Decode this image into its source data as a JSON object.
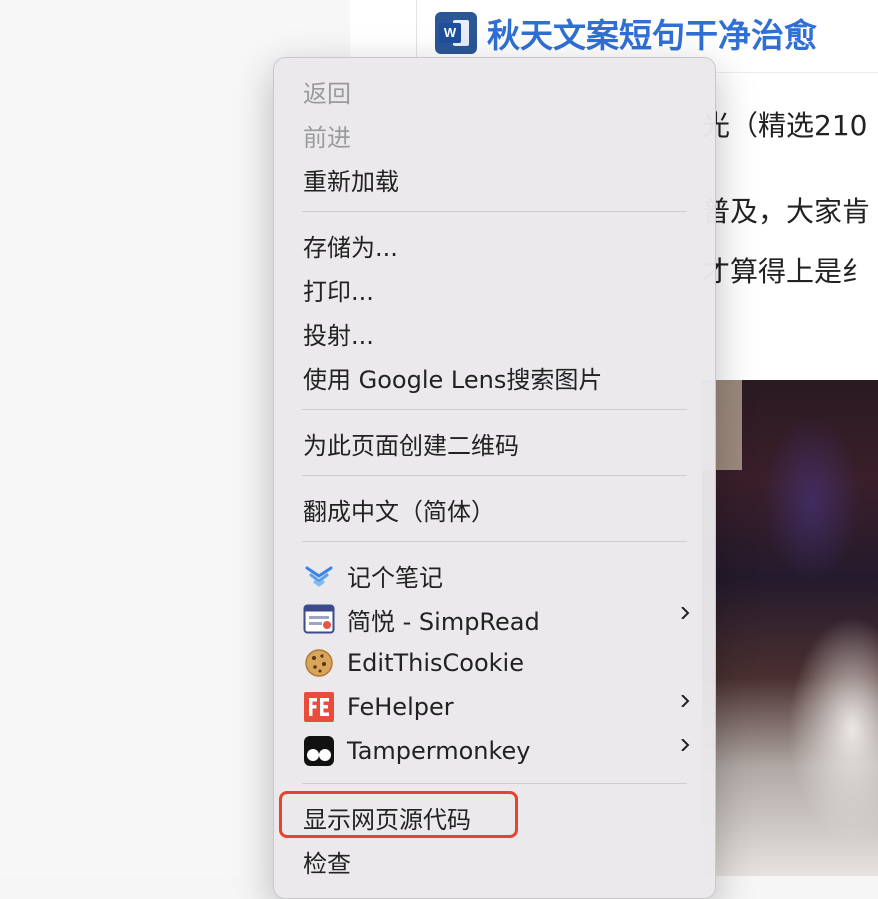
{
  "page": {
    "title": "秋天文案短句干净治愈",
    "doc_icon_letter": "W",
    "body_lines": [
      "光（精选210",
      "普及，大家肯",
      "才算得上是纟"
    ]
  },
  "menu": {
    "back": "返回",
    "forward": "前进",
    "reload": "重新加载",
    "save_as": "存储为...",
    "print": "打印...",
    "cast": "投射...",
    "google_lens": "使用 Google Lens搜索图片",
    "qr_code": "为此页面创建二维码",
    "translate": "翻成中文（简体）",
    "extensions": [
      {
        "label": "记个笔记",
        "icon": "note-icon",
        "submenu": false
      },
      {
        "label": "简悦 - SimpRead",
        "icon": "simpread-icon",
        "submenu": true
      },
      {
        "label": "EditThisCookie",
        "icon": "cookie-icon",
        "submenu": false
      },
      {
        "label": "FeHelper",
        "icon": "fehelper-icon",
        "submenu": true
      },
      {
        "label": "Tampermonkey",
        "icon": "tampermonkey-icon",
        "submenu": true
      }
    ],
    "view_source": "显示网页源代码",
    "inspect": "检查"
  },
  "colors": {
    "title": "#2f6fd6",
    "highlight": "#e8432d",
    "disabled": "#9b9b9f"
  }
}
